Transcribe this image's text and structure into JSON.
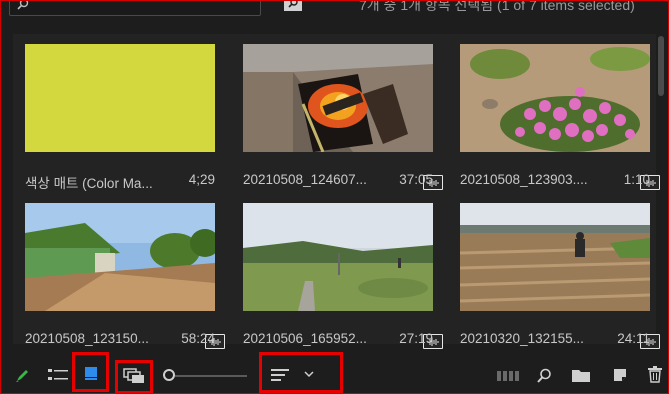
{
  "topbar": {
    "search_placeholder": "",
    "status": "7개 중 1개 항목 선택됨 (1 of 7 items selected)"
  },
  "items": [
    {
      "name": "색상 매트 (Color Ma...",
      "duration": "4;29",
      "has_audio_badge": false
    },
    {
      "name": "20210508_124607...",
      "duration": "37:05",
      "has_audio_badge": true
    },
    {
      "name": "20210508_123903....",
      "duration": "1:10",
      "has_audio_badge": true
    },
    {
      "name": "20210508_123150...",
      "duration": "58:24",
      "has_audio_badge": true
    },
    {
      "name": "20210506_165952...",
      "duration": "27:19",
      "has_audio_badge": true
    },
    {
      "name": "20210320_132155...",
      "duration": "24:11",
      "has_audio_badge": true
    }
  ],
  "toolbar": {
    "icons": [
      "pencil-icon",
      "list-view-icon",
      "icon-view-icon",
      "freeform-view-icon",
      "zoom-slider",
      "sort-icon",
      "chevron-down-icon",
      "automate-icon",
      "find-icon",
      "new-bin-icon",
      "new-item-icon",
      "trash-icon"
    ],
    "active_view": "icon-view"
  },
  "colors": {
    "background": "#1d1d1d",
    "panel": "#232323",
    "color_matte": "#d3d83f",
    "accent_blue": "#2d8ceb",
    "pencil_green": "#39b54a",
    "highlight_red": "#e60000"
  }
}
